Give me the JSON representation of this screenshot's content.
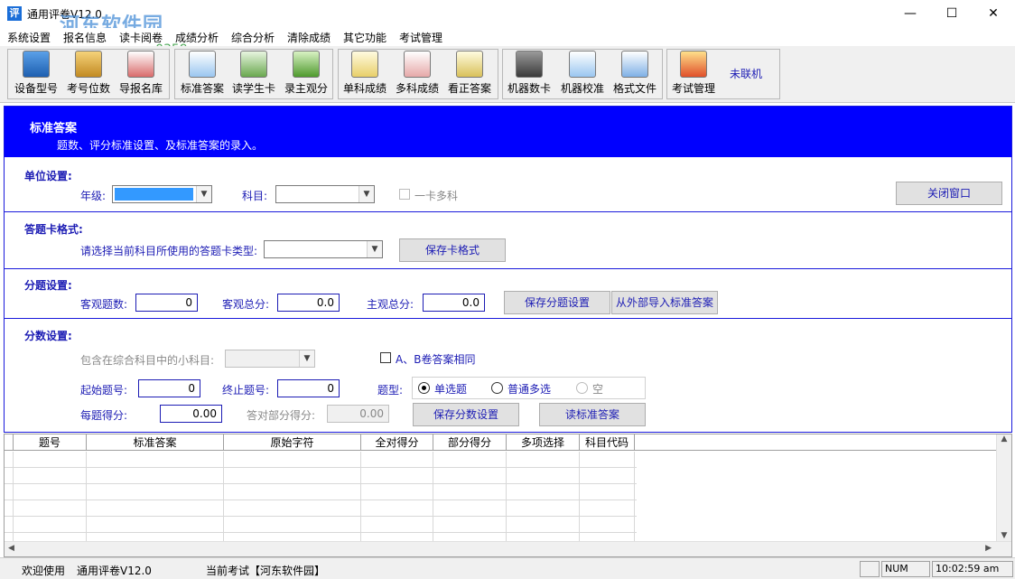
{
  "window": {
    "title": "通用评卷V12.0",
    "watermark": "河东软件园",
    "watermark_url": "www.pc0359.cn",
    "minimize": "—",
    "maximize": "☐",
    "close": "✕"
  },
  "menu": [
    "系统设置",
    "报名信息",
    "读卡阅卷",
    "成绩分析",
    "综合分析",
    "清除成绩",
    "其它功能",
    "考试管理"
  ],
  "toolbar": {
    "buttons": [
      "设备型号",
      "考号位数",
      "导报名库",
      "标准答案",
      "读学生卡",
      "录主观分",
      "单科成绩",
      "多科成绩",
      "看正答案",
      "机器数卡",
      "机器校准",
      "格式文件",
      "考试管理"
    ],
    "status": "未联机"
  },
  "header": {
    "title": "标准答案",
    "subtitle": "题数、评分标准设置、及标准答案的录入。"
  },
  "unit": {
    "section_title": "单位设置:",
    "grade_label": "年级:",
    "subject_label": "科目:",
    "multi_subject_label": "一卡多科",
    "close_button": "关闭窗口"
  },
  "card_format": {
    "section_title": "答题卡格式:",
    "prompt": "请选择当前科目所使用的答题卡类型:",
    "save_button": "保存卡格式"
  },
  "subquestion": {
    "section_title": "分题设置:",
    "objective_count_label": "客观题数:",
    "objective_count": "0",
    "objective_total_label": "客观总分:",
    "objective_total": "0.0",
    "subjective_total_label": "主观总分:",
    "subjective_total": "0.0",
    "save_button": "保存分题设置",
    "import_button": "从外部导入标准答案"
  },
  "score": {
    "section_title": "分数设置:",
    "sub_subject_label": "包含在综合科目中的小科目:",
    "ab_same_label": "A、B卷答案相同",
    "start_label": "起始题号:",
    "start_value": "0",
    "end_label": "终止题号:",
    "end_value": "0",
    "type_label": "题型:",
    "types": [
      "单选题",
      "普通多选",
      "空"
    ],
    "selected_type": "单选题",
    "per_score_label": "每题得分:",
    "per_score_value": "0.00",
    "partial_label": "答对部分得分:",
    "partial_value": "0.00",
    "save_button": "保存分数设置",
    "read_button": "读标准答案"
  },
  "grid": {
    "columns": [
      "题号",
      "标准答案",
      "原始字符",
      "全对得分",
      "部分得分",
      "多项选择",
      "科目代码"
    ]
  },
  "statusbar": {
    "welcome": "欢迎使用",
    "app": "通用评卷V12.0",
    "current_exam": "当前考试【河东软件园】",
    "num": "NUM",
    "time": "10:02:59 am"
  }
}
